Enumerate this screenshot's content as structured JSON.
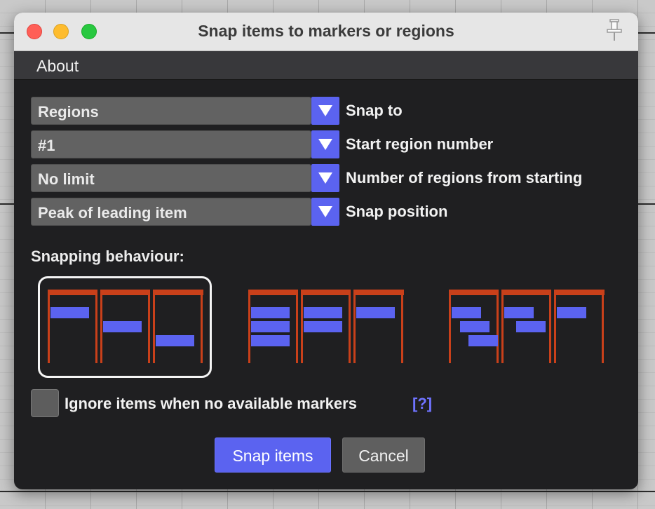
{
  "window": {
    "title": "Snap items to markers or regions"
  },
  "menu": {
    "items": [
      "About"
    ]
  },
  "settings": {
    "rows": [
      {
        "value": "Regions",
        "label": "Snap to"
      },
      {
        "value": "#1",
        "label": "Start region number"
      },
      {
        "value": "No limit",
        "label": "Number of regions from starting"
      },
      {
        "value": "Peak of leading item",
        "label": "Snap position"
      }
    ]
  },
  "behaviour": {
    "label": "Snapping behaviour:",
    "selected_index": 0,
    "options": [
      "staggered",
      "stacked-first",
      "cascade"
    ]
  },
  "ignore_option": {
    "label": "Ignore items when no available markers",
    "help": "[?]",
    "checked": false
  },
  "buttons": {
    "snap": "Snap items",
    "cancel": "Cancel"
  },
  "colors": {
    "accent": "#5b63f0",
    "region": "#c9401a",
    "item": "#5b63f0"
  }
}
